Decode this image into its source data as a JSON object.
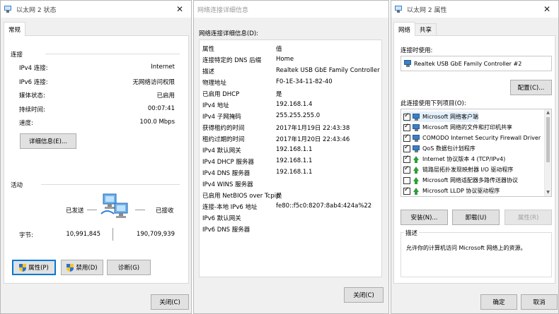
{
  "status_window": {
    "title": "以太网 2 状态",
    "tab": "常规",
    "connection_group": "连接",
    "rows": [
      {
        "label": "IPv4 连接:",
        "value": "Internet"
      },
      {
        "label": "IPv6 连接:",
        "value": "无网络访问权限"
      },
      {
        "label": "媒体状态:",
        "value": "已启用"
      },
      {
        "label": "持续时间:",
        "value": "00:07:41"
      },
      {
        "label": "速度:",
        "value": "100.0 Mbps"
      }
    ],
    "details_button": "详细信息(E)...",
    "activity_group": "活动",
    "sent_label": "已发送",
    "received_label": "已接收",
    "bytes_label": "字节:",
    "bytes_sent": "10,991,845",
    "bytes_received": "190,709,939",
    "properties_button": "属性(P)",
    "disable_button": "禁用(D)",
    "diagnose_button": "诊断(G)",
    "close_button": "关闭(C)"
  },
  "details_window": {
    "title": "网络连接详细信息",
    "caption": "网络连接详细信息(D):",
    "header": {
      "property": "属性",
      "value": "值"
    },
    "rows": [
      {
        "property": "连接特定的 DNS 后缀",
        "value": "Home"
      },
      {
        "property": "描述",
        "value": "Realtek USB GbE Family Controller #2"
      },
      {
        "property": "物理地址",
        "value": "F0-1E-34-11-82-40"
      },
      {
        "property": "已启用 DHCP",
        "value": "是"
      },
      {
        "property": "IPv4 地址",
        "value": "192.168.1.4"
      },
      {
        "property": "IPv4 子网掩码",
        "value": "255.255.255.0"
      },
      {
        "property": "获得租约的时间",
        "value": "2017年1月19日 22:43:38"
      },
      {
        "property": "租约过期的时间",
        "value": "2017年1月20日 22:43:46"
      },
      {
        "property": "IPv4 默认网关",
        "value": "192.168.1.1"
      },
      {
        "property": "IPv4 DHCP 服务器",
        "value": "192.168.1.1"
      },
      {
        "property": "IPv4 DNS 服务器",
        "value": "192.168.1.1"
      },
      {
        "property": "IPv4 WINS 服务器",
        "value": ""
      },
      {
        "property": "已启用 NetBIOS over Tcpip",
        "value": "是"
      },
      {
        "property": "连接-本地 IPv6 地址",
        "value": "fe80::f5c0:8207:8ab4:424a%22"
      },
      {
        "property": "IPv6 默认网关",
        "value": ""
      },
      {
        "property": "IPv6 DNS 服务器",
        "value": ""
      }
    ],
    "close_button": "关闭(C)"
  },
  "properties_window": {
    "title": "以太网 2 属性",
    "tabs": [
      "网络",
      "共享"
    ],
    "connect_using_label": "连接时使用:",
    "adapter_name": "Realtek USB GbE Family Controller #2",
    "configure_button": "配置(C)...",
    "items_label": "此连接使用下列项目(O):",
    "items": [
      {
        "label": "Microsoft 网络客户端",
        "checked": true,
        "icon": "network-client-icon"
      },
      {
        "label": "Microsoft 网络的文件和打印机共享",
        "checked": true,
        "icon": "network-client-icon"
      },
      {
        "label": "COMODO Internet Security Firewall Driver",
        "checked": true,
        "icon": "network-client-icon"
      },
      {
        "label": "QoS 数据包计划程序",
        "checked": true,
        "icon": "network-client-icon"
      },
      {
        "label": "Internet 协议版本 4 (TCP/IPv4)",
        "checked": true,
        "icon": "protocol-icon"
      },
      {
        "label": "链路层拓扑发现映射器 I/O 驱动程序",
        "checked": true,
        "icon": "protocol-icon"
      },
      {
        "label": "Microsoft 网络适配器多路传送器协议",
        "checked": false,
        "icon": "protocol-icon"
      },
      {
        "label": "Microsoft LLDP 协议驱动程序",
        "checked": true,
        "icon": "protocol-icon"
      }
    ],
    "install_button": "安装(N)...",
    "uninstall_button": "卸载(U)",
    "properties_button": "属性(R)",
    "description_group": "描述",
    "description_text": "允许你的计算机访问 Microsoft 网络上的资源。",
    "ok_button": "确定",
    "cancel_button": "取消"
  }
}
